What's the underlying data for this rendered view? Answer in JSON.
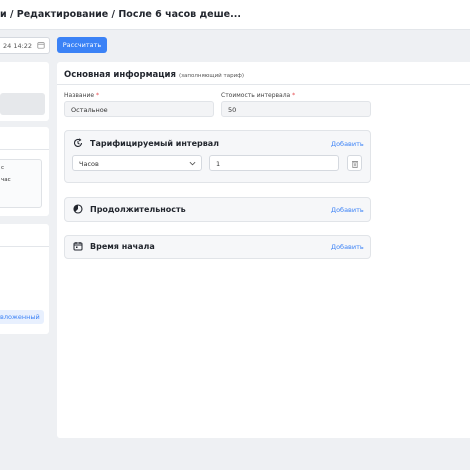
{
  "header": {
    "breadcrumb": "и / Редактирование / После 6 часов деше..."
  },
  "toolbar": {
    "date_value": "24 14:22",
    "calculate_label": "Рассчитать"
  },
  "left_panel": {
    "card_text_1": "с",
    "card_text_2": "час",
    "nested_link": "вложенный"
  },
  "main": {
    "title": "Основная информация",
    "subtitle": "(заполняющий тариф)",
    "name_label": "Название",
    "name_value": "Остальное",
    "cost_label": "Стоимость интервала",
    "cost_value": "50",
    "required_mark": "*"
  },
  "sections": {
    "interval": {
      "title": "Тарифицируемый интервал",
      "add": "Добавить",
      "unit_selected": "Часов",
      "count_value": "1"
    },
    "duration": {
      "title": "Продолжительность",
      "add": "Добавить"
    },
    "start_time": {
      "title": "Время начала",
      "add": "Добавить"
    }
  },
  "colors": {
    "accent": "#3b82f6",
    "background": "#eef0f3",
    "required": "#e5484d"
  },
  "icons": [
    "calendar-icon",
    "interval-clock-icon",
    "chevron-down-icon",
    "trash-icon",
    "duration-icon",
    "calendar-start-icon"
  ]
}
